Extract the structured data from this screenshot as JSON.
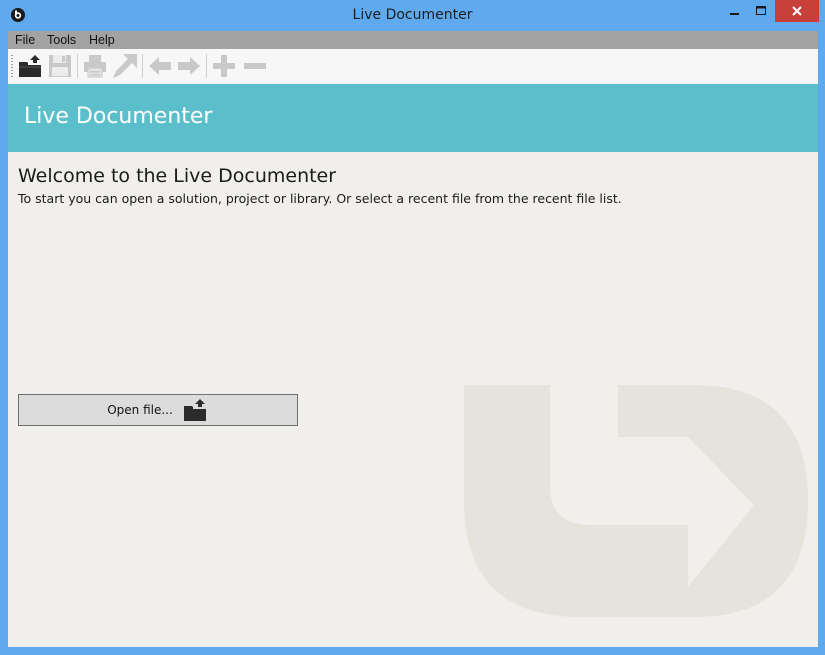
{
  "window": {
    "title": "Live Documenter"
  },
  "menu": {
    "items": [
      {
        "label": "File"
      },
      {
        "label": "Tools"
      },
      {
        "label": "Help"
      }
    ]
  },
  "toolbar": {
    "buttons": [
      {
        "icon": "open-folder-icon",
        "enabled": true
      },
      {
        "icon": "save-icon",
        "enabled": false
      },
      {
        "icon": "print-icon",
        "enabled": false
      },
      {
        "icon": "export-arrow-icon",
        "enabled": false
      },
      {
        "icon": "back-arrow-icon",
        "enabled": false
      },
      {
        "icon": "forward-arrow-icon",
        "enabled": false
      },
      {
        "icon": "plus-icon",
        "enabled": false
      },
      {
        "icon": "minus-icon",
        "enabled": false
      }
    ]
  },
  "banner": {
    "title": "Live Documenter"
  },
  "welcome": {
    "heading": "Welcome to the Live Documenter",
    "text": "To start you can open a solution, project or library. Or select a recent file from the recent file list."
  },
  "open_file": {
    "label": "Open file..."
  },
  "colors": {
    "window_frame": "#5fa9ee",
    "banner": "#5abfcb",
    "close_button": "#c7413a",
    "background": "#f0efeb",
    "watermark": "#e4e3dc"
  }
}
